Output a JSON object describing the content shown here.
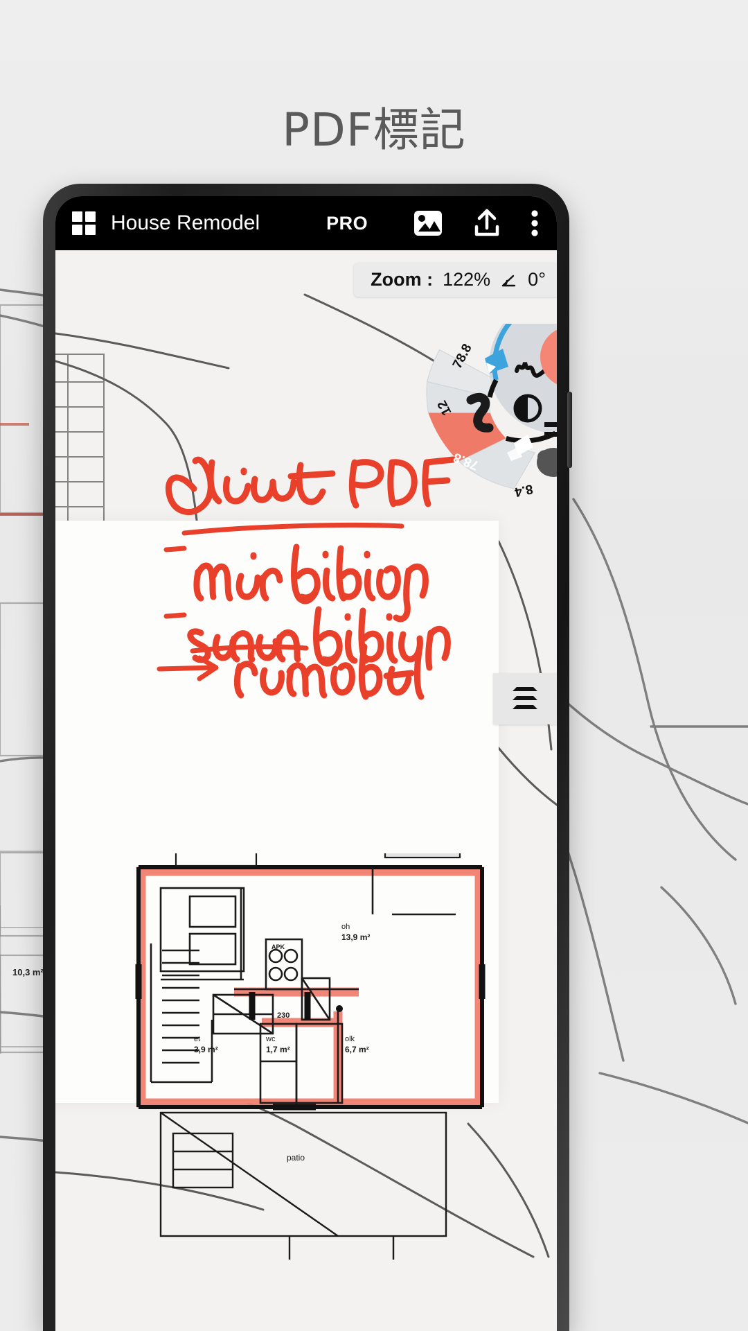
{
  "promo": {
    "headline": "PDF標記",
    "background_color": "#ececec",
    "text_color": "#5a5a5a"
  },
  "phone": {
    "frame_color": "#1e1e1e",
    "appbar": {
      "background": "#000000",
      "grid_icon": "grid-icon",
      "title": "House Remodel",
      "pro_badge": "PRO",
      "actions": [
        {
          "name": "image-icon",
          "label": "Image"
        },
        {
          "name": "upload-icon",
          "label": "Upload"
        },
        {
          "name": "more-vertical-icon",
          "label": "More options"
        }
      ]
    },
    "zoom_bar": {
      "label": "Zoom :",
      "value": "122%",
      "angle_icon": "angle-icon",
      "angle": "0°"
    },
    "radial_menu": {
      "accent_color": "#f07a68",
      "ring_background": "#d6dade",
      "segments": [
        {
          "name": "segment-eraser",
          "label": "78.8",
          "icon": "blue-eraser-icon",
          "color": "#3da3dd",
          "selected": false
        },
        {
          "name": "segment-brush",
          "label": "12",
          "icon": "black-brush-icon",
          "color": "#222222",
          "selected": false
        },
        {
          "name": "segment-highlighter",
          "label": "78.8",
          "icon": "white-highlighter-icon",
          "color": "#f07a68",
          "selected": true
        },
        {
          "name": "segment-smudge",
          "label": "8.4",
          "icon": "gray-smudge-icon",
          "color": "#555555",
          "selected": false
        }
      ],
      "inner": [
        {
          "name": "scribble-icon",
          "label": "Stroke style"
        },
        {
          "name": "contrast-icon",
          "label": "Opacity"
        },
        {
          "name": "equals-icon",
          "label": "Thickness"
        },
        {
          "name": "color-swatch",
          "label": "Colour",
          "color": "#f58675"
        }
      ]
    },
    "layers_button": {
      "name": "layers-icon",
      "label": "Layers"
    },
    "annotations": {
      "ink_color": "#e8402a",
      "title": "Client PDF",
      "lines": [
        {
          "marker": "—",
          "text": "main building"
        },
        {
          "marker": "—",
          "text": "sauna building",
          "strikethrough": true
        },
        {
          "marker": "→",
          "text": "remodel"
        }
      ]
    },
    "floorplan": {
      "rooms": [
        {
          "code": "oh",
          "area": "13,9",
          "unit": "m²"
        },
        {
          "code": "et",
          "area": "3,9",
          "unit": "m²"
        },
        {
          "code": "wc",
          "area": "1,7",
          "unit": "m²"
        },
        {
          "code": "olk",
          "area": "6,7",
          "unit": "m²"
        },
        {
          "code": "patio",
          "area": "",
          "unit": ""
        }
      ],
      "dimension_note": "230",
      "appliance_note": "APK",
      "outside_label": "10,3  m²"
    }
  }
}
